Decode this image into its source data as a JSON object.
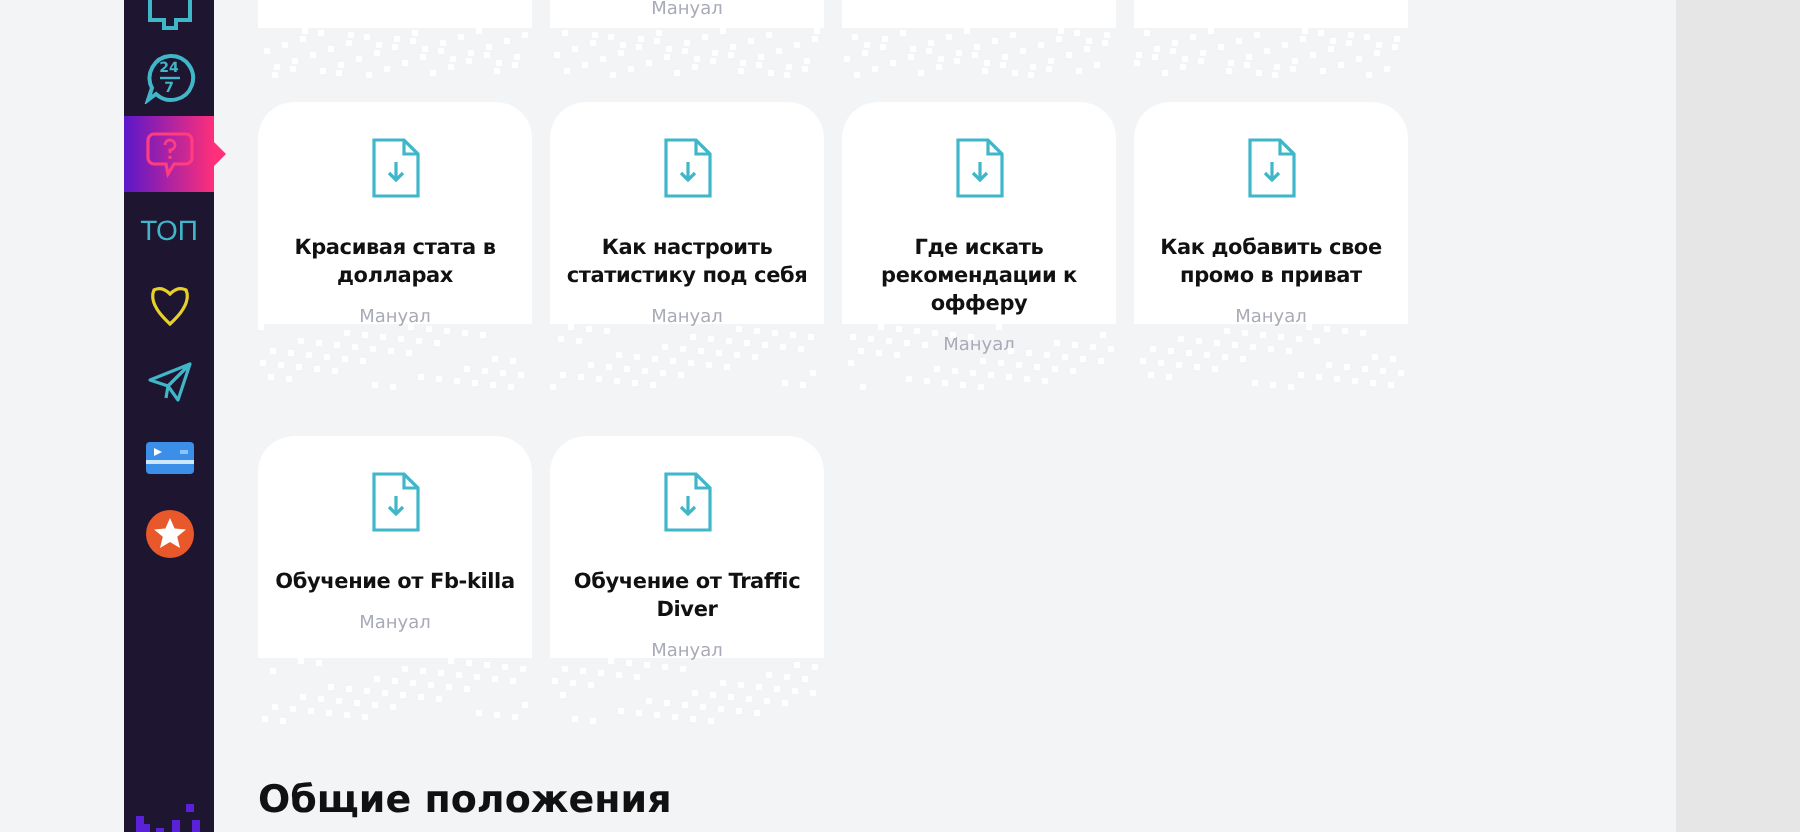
{
  "sidebar": {
    "items": [
      {
        "kind": "puzzle",
        "selected": false
      },
      {
        "kind": "support",
        "top_text": "24",
        "bottom_text": "7",
        "selected": false
      },
      {
        "kind": "question",
        "selected": true
      },
      {
        "kind": "text",
        "label": "ТОП",
        "selected": false
      },
      {
        "kind": "heart",
        "selected": false
      },
      {
        "kind": "plane",
        "selected": false
      },
      {
        "kind": "card",
        "selected": false
      },
      {
        "kind": "star",
        "selected": false
      }
    ]
  },
  "top_cards": [
    {
      "kind": "blank"
    },
    {
      "kind": "tagged",
      "tag": "Мануал"
    },
    {
      "kind": "blank"
    },
    {
      "kind": "blank"
    }
  ],
  "cards": [
    {
      "title": "Красивая стата в долларах",
      "tag": "Мануал"
    },
    {
      "title": "Как настроить статистику под себя",
      "tag": "Мануал"
    },
    {
      "title": "Где искать рекомендации к офферу",
      "tag": "Мануал"
    },
    {
      "title": "Как добавить свое промо в приват",
      "tag": "Мануал"
    },
    {
      "title": "Обучение от Fb-killa",
      "tag": "Мануал"
    },
    {
      "title": "Обучение от Traffic Diver",
      "tag": "Мануал"
    }
  ],
  "section_heading": "Общие положения"
}
